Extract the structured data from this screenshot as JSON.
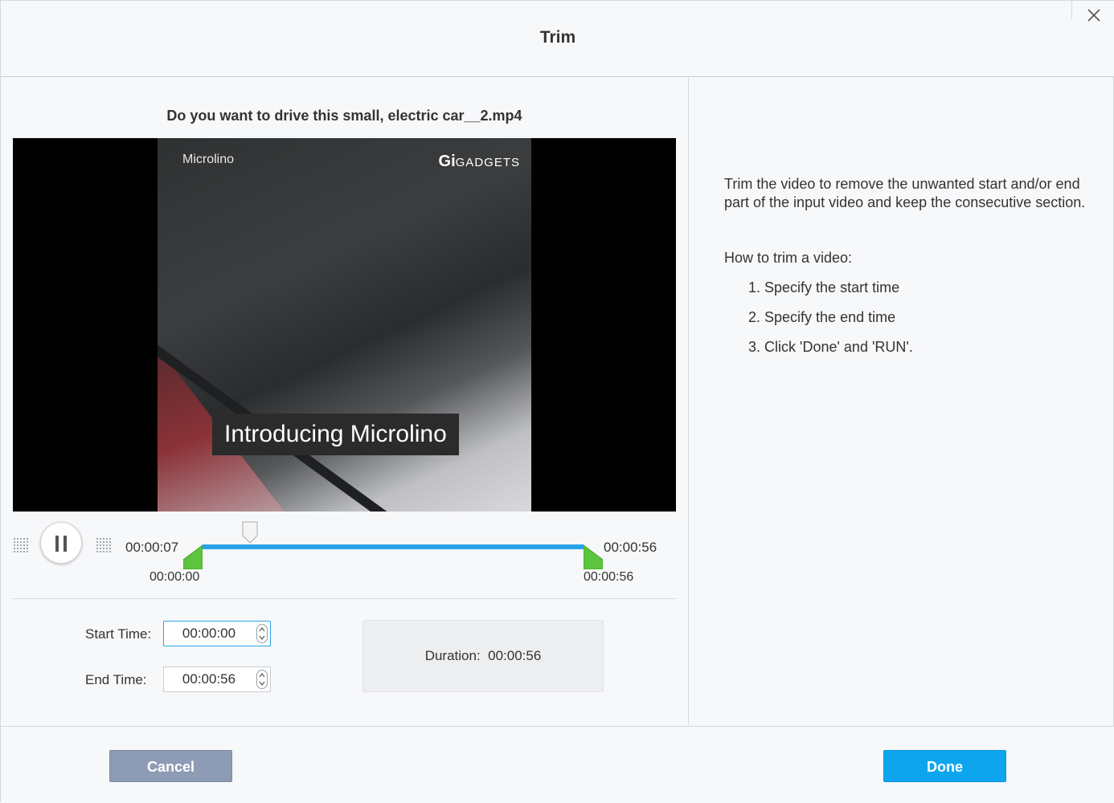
{
  "dialog": {
    "title": "Trim"
  },
  "video": {
    "filename": "Do you want to drive this small, electric car__2.mp4",
    "watermark_left": "Microlino",
    "watermark_right_prefix": "Gi",
    "watermark_right": "GADGETS",
    "caption": "Introducing Microlino"
  },
  "player": {
    "current_time": "00:00:07",
    "total_time": "00:00:56",
    "range_start_label": "00:00:00",
    "range_end_label": "00:00:56",
    "play_state_icon": "pause-icon",
    "playhead_fraction": 0.125,
    "selection_start_fraction": 0.0,
    "selection_end_fraction": 1.0,
    "accent_color": "#2aa3e8",
    "handle_color": "#5cc43e"
  },
  "trim": {
    "start_label": "Start Time:",
    "start_value": "00:00:00",
    "end_label": "End Time:",
    "end_value": "00:00:56",
    "duration_label": "Duration:",
    "duration_value": "00:00:56"
  },
  "help": {
    "description": "Trim the video to remove the unwanted start and/or end part of the input video and keep the consecutive section.",
    "howto_title": "How to trim a video:",
    "steps": [
      "1. Specify the start time",
      "2. Specify the end time",
      "3. Click 'Done' and 'RUN'."
    ]
  },
  "footer": {
    "cancel_label": "Cancel",
    "done_label": "Done",
    "cancel_color": "#8e9bb5",
    "done_color": "#0ea5ef"
  }
}
